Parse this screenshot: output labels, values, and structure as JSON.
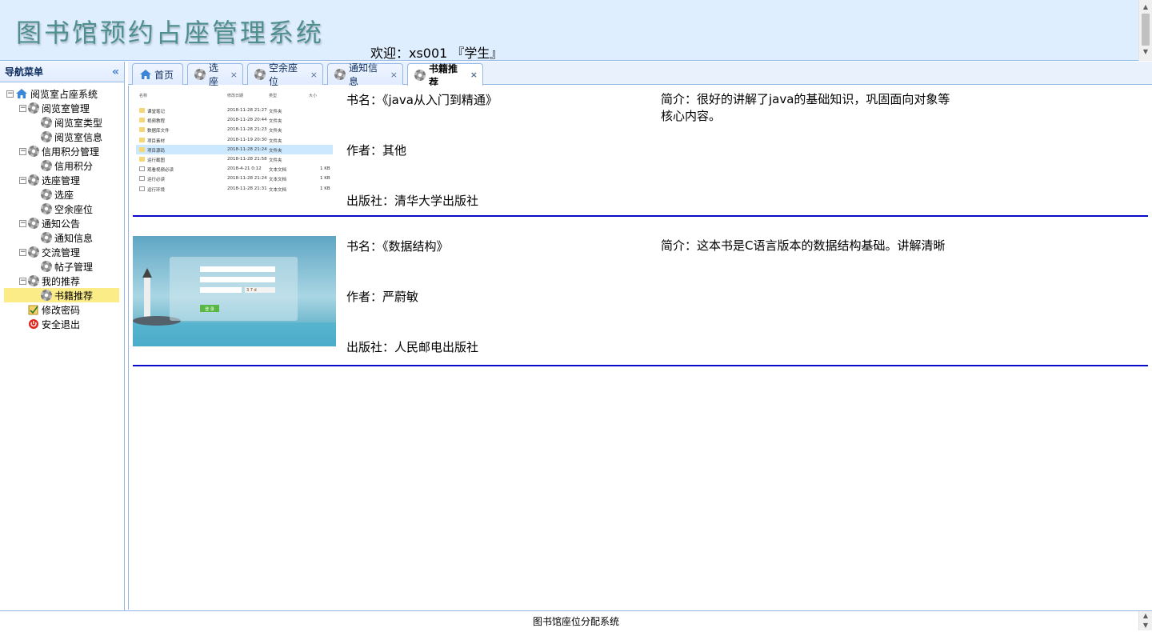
{
  "header": {
    "title": "图书馆预约占座管理系统",
    "welcome": "欢迎：xs001 『学生』"
  },
  "sidebar": {
    "title": "导航菜单",
    "tree": [
      {
        "label": "阅览室占座系统",
        "level": 0,
        "icon": "home-icon",
        "toggle": "−"
      },
      {
        "label": "阅览室管理",
        "level": 1,
        "icon": "gear-icon",
        "toggle": "−"
      },
      {
        "label": "阅览室类型",
        "level": 2,
        "icon": "gear-icon"
      },
      {
        "label": "阅览室信息",
        "level": 2,
        "icon": "gear-icon"
      },
      {
        "label": "信用积分管理",
        "level": 1,
        "icon": "gear-icon",
        "toggle": "−"
      },
      {
        "label": "信用积分",
        "level": 2,
        "icon": "gear-icon"
      },
      {
        "label": "选座管理",
        "level": 1,
        "icon": "gear-icon",
        "toggle": "−"
      },
      {
        "label": "选座",
        "level": 2,
        "icon": "gear-icon"
      },
      {
        "label": "空余座位",
        "level": 2,
        "icon": "gear-icon"
      },
      {
        "label": "通知公告",
        "level": 1,
        "icon": "gear-icon",
        "toggle": "−"
      },
      {
        "label": "通知信息",
        "level": 2,
        "icon": "gear-icon"
      },
      {
        "label": "交流管理",
        "level": 1,
        "icon": "gear-icon",
        "toggle": "−"
      },
      {
        "label": "帖子管理",
        "level": 2,
        "icon": "gear-icon"
      },
      {
        "label": "我的推荐",
        "level": 1,
        "icon": "gear-icon",
        "toggle": "−"
      },
      {
        "label": "书籍推荐",
        "level": 2,
        "icon": "gear-icon",
        "selected": true
      },
      {
        "label": "修改密码",
        "level": 1,
        "icon": "edit-password-icon"
      },
      {
        "label": "安全退出",
        "level": 1,
        "icon": "logout-icon"
      }
    ]
  },
  "tabs": [
    {
      "label": "首页",
      "icon": "home-icon",
      "closable": false
    },
    {
      "label": "选座",
      "icon": "gear-icon",
      "closable": true
    },
    {
      "label": "空余座位",
      "icon": "gear-icon",
      "closable": true
    },
    {
      "label": "通知信息",
      "icon": "gear-icon",
      "closable": true
    },
    {
      "label": "书籍推荐",
      "icon": "gear-icon",
      "closable": true,
      "active": true
    }
  ],
  "books": [
    {
      "name": "书名：《java从入门到精通》",
      "author": "作者：其他",
      "publisher": "出版社：清华大学出版社",
      "intro": "简介：很好的讲解了java的基础知识，巩固面向对象等核心内容。",
      "cover": {
        "headers": [
          "名称",
          "修改日期",
          "类型",
          "大小"
        ],
        "rows": [
          {
            "name": "课堂笔记",
            "date": "2018-11-28 21:27",
            "type": "文件夹",
            "size": "",
            "folder": true
          },
          {
            "name": "视频教程",
            "date": "2018-11-28 20:44",
            "type": "文件夹",
            "size": "",
            "folder": true
          },
          {
            "name": "数据库文件",
            "date": "2018-11-28 21:23",
            "type": "文件夹",
            "size": "",
            "folder": true
          },
          {
            "name": "项目素材",
            "date": "2018-11-19 20:30",
            "type": "文件夹",
            "size": "",
            "folder": true
          },
          {
            "name": "项目源码",
            "date": "2018-11-28 21:24",
            "type": "文件夹",
            "size": "",
            "folder": true,
            "highlight": true
          },
          {
            "name": "运行截图",
            "date": "2018-11-28 21:58",
            "type": "文件夹",
            "size": "",
            "folder": true
          },
          {
            "name": "观看视频必读",
            "date": "2018-4-21 0:12",
            "type": "文本文档",
            "size": "1 KB",
            "folder": false
          },
          {
            "name": "运行必读",
            "date": "2018-11-28 21:24",
            "type": "文本文档",
            "size": "1 KB",
            "folder": false
          },
          {
            "name": "运行环境",
            "date": "2018-11-28 21:31",
            "type": "文本文档",
            "size": "1 KB",
            "folder": false
          }
        ]
      }
    },
    {
      "name": "书名：《数据结构》",
      "author": "作者：严蔚敏",
      "publisher": "出版社：人民邮电出版社",
      "intro": "简介：这本书是C语言版本的数据结构基础。讲解清晰",
      "cover": {
        "login_button": "登 录",
        "captcha": "3 7 d"
      }
    }
  ],
  "footer": {
    "text": "图书馆座位分配系统"
  },
  "colors": {
    "header_bg": "#dfeeff",
    "panel_border": "#95b8e7",
    "selected_bg": "#fbec88",
    "divider": "#0a0acb",
    "title_color": "#4f8f8c"
  }
}
